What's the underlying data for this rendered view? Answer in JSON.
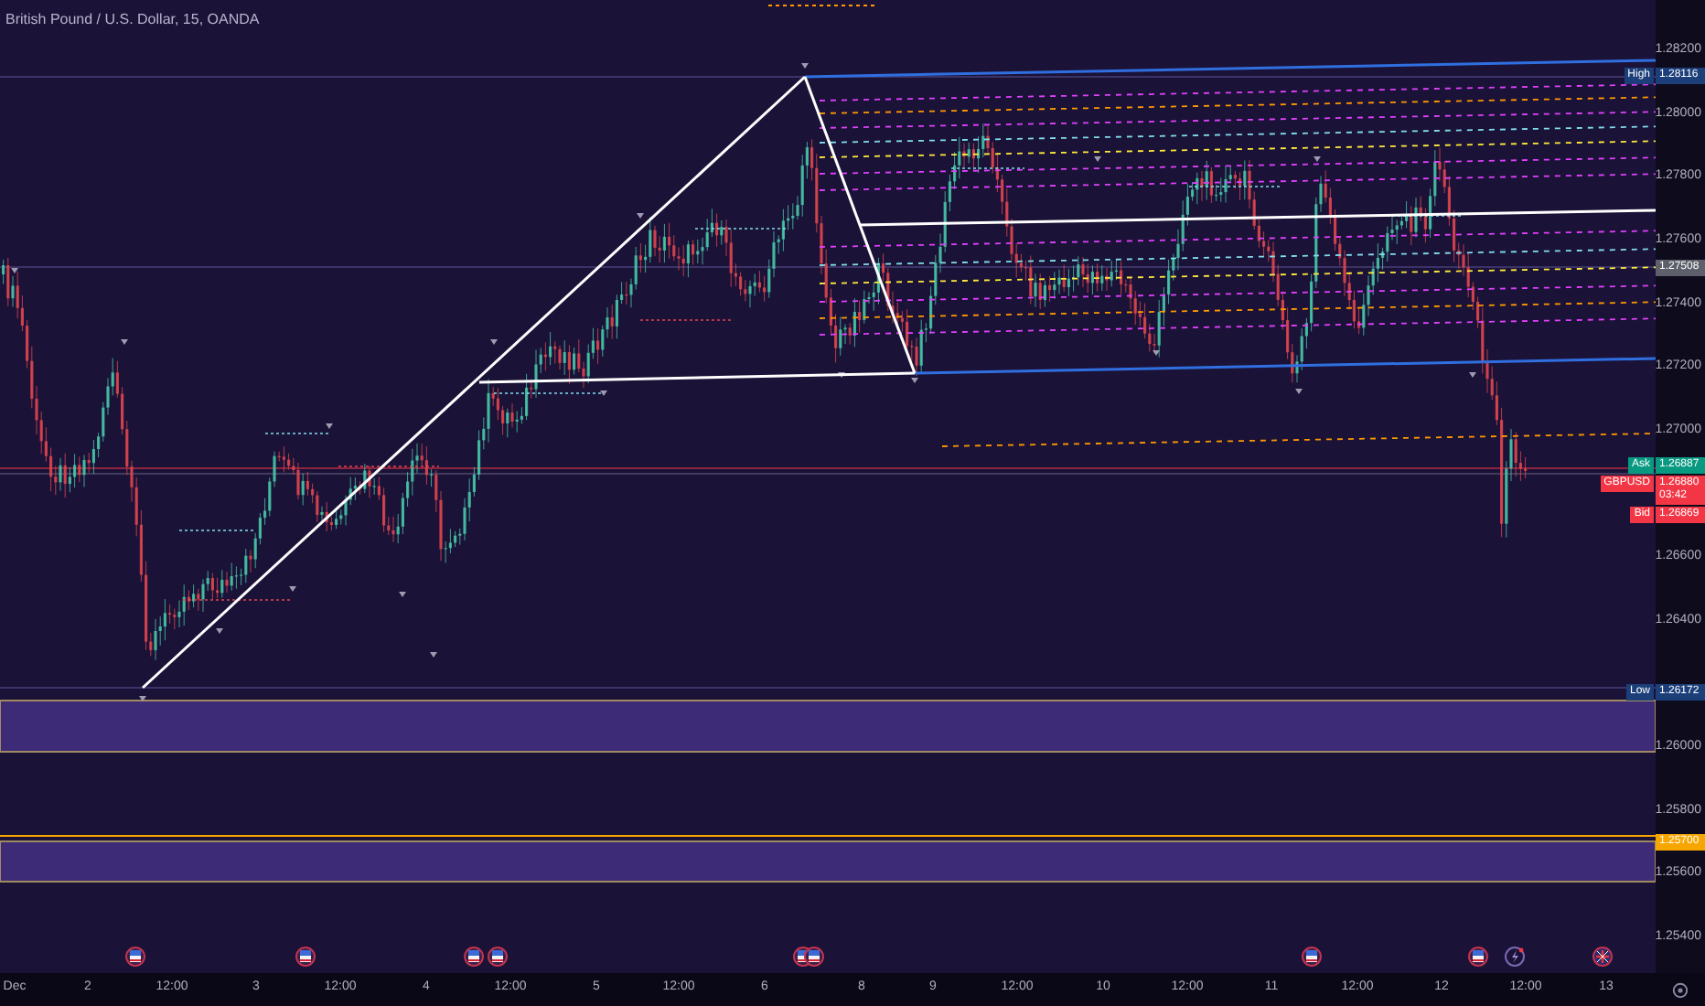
{
  "chart": {
    "title": "British Pound / U.S. Dollar, 15, OANDA"
  },
  "price_axis": {
    "labels": [
      "1.28200",
      "1.28000",
      "1.27800",
      "1.27600",
      "1.27400",
      "1.27200",
      "1.27000",
      "1.26600",
      "1.26400",
      "1.26000",
      "1.25800",
      "1.25600",
      "1.25400"
    ]
  },
  "price_markers": [
    {
      "kind": "tagged",
      "tag": "High",
      "value": "1.28116",
      "color": "#1c3f7a"
    },
    {
      "kind": "plain",
      "value": "1.27508",
      "color": "#5d606b"
    },
    {
      "kind": "tagged",
      "tag": "Ask",
      "value": "1.26887",
      "color": "#089981"
    },
    {
      "kind": "last",
      "tag": "GBPUSD",
      "value": "1.26880",
      "countdown": "03:42",
      "color": "#f23645"
    },
    {
      "kind": "tagged",
      "tag": "Bid",
      "value": "1.26869",
      "color": "#f23645"
    },
    {
      "kind": "tagged",
      "tag": "Low",
      "value": "1.26172",
      "color": "#1c3f7a"
    },
    {
      "kind": "plain",
      "value": "1.25700",
      "color": "#f7a600"
    }
  ],
  "time_axis": {
    "labels": [
      "Dec",
      "2",
      "12:00",
      "3",
      "12:00",
      "4",
      "12:00",
      "5",
      "12:00",
      "6",
      "8",
      "9",
      "12:00",
      "10",
      "12:00",
      "11",
      "12:00",
      "12",
      "12:00",
      "13"
    ]
  }
}
